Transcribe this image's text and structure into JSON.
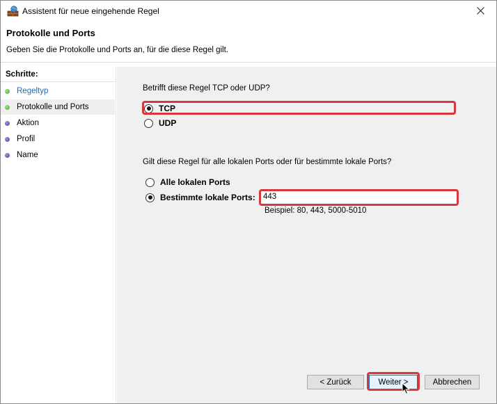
{
  "window": {
    "title": "Assistent für neue eingehende Regel",
    "title_icon": "firewall-wizard-icon",
    "close_icon": "close-icon"
  },
  "header": {
    "title": "Protokolle und Ports",
    "subtitle": "Geben Sie die Protokolle und Ports an, für die diese Regel gilt."
  },
  "sidebar": {
    "heading": "Schritte:",
    "steps": [
      {
        "label": "Regeltyp",
        "state": "done"
      },
      {
        "label": "Protokolle und Ports",
        "state": "current"
      },
      {
        "label": "Aktion",
        "state": "pending"
      },
      {
        "label": "Profil",
        "state": "pending"
      },
      {
        "label": "Name",
        "state": "pending"
      }
    ]
  },
  "protocol": {
    "question": "Betrifft diese Regel TCP oder UDP?",
    "options": [
      {
        "label": "TCP",
        "checked": true
      },
      {
        "label": "UDP",
        "checked": false
      }
    ]
  },
  "ports": {
    "question": "Gilt diese Regel für alle lokalen Ports oder für bestimmte lokale Ports?",
    "options": [
      {
        "label": "Alle lokalen Ports",
        "checked": false
      },
      {
        "label": "Bestimmte lokale Ports:",
        "checked": true
      }
    ],
    "input_value": "443",
    "example": "Beispiel: 80, 443, 5000-5010"
  },
  "footer": {
    "back_label": "< Zurück",
    "next_label": "Weiter >",
    "cancel_label": "Abbrechen"
  },
  "colors": {
    "highlight": "#d8373f",
    "link": "#2a6ab0",
    "panel_bg": "#f0f0f0"
  }
}
